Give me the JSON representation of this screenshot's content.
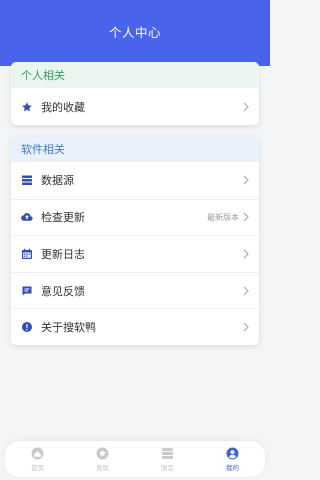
{
  "header": {
    "title": "个人中心"
  },
  "colors": {
    "primary": "#4a63ec",
    "accent": "#2d4fb8",
    "personal_section": "#2f9e5a",
    "software_section": "#3f79c9"
  },
  "personal": {
    "title": "个人相关",
    "items": [
      {
        "label": "我的收藏",
        "icon": "star-icon"
      }
    ]
  },
  "software": {
    "title": "软件相关",
    "items": [
      {
        "label": "数据源",
        "icon": "database-icon"
      },
      {
        "label": "检查更新",
        "icon": "cloud-upload-icon",
        "extra": "最新版本"
      },
      {
        "label": "更新日志",
        "icon": "calendar-icon"
      },
      {
        "label": "意见反馈",
        "icon": "chat-icon"
      },
      {
        "label": "关于搜软鸭",
        "icon": "info-icon"
      }
    ]
  },
  "nav": {
    "items": [
      {
        "label": "首页",
        "icon": "home-icon"
      },
      {
        "label": "发现",
        "icon": "discover-icon"
      },
      {
        "label": "限定",
        "icon": "list-icon"
      },
      {
        "label": "我的",
        "icon": "user-icon",
        "active": true
      }
    ]
  }
}
